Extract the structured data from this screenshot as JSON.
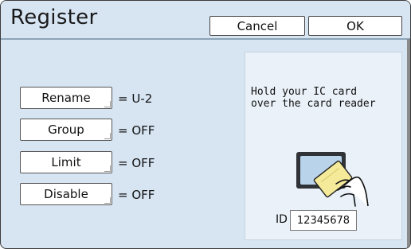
{
  "window": {
    "title": "Register"
  },
  "header": {
    "cancel_label": "Cancel",
    "ok_label": "OK"
  },
  "settings": [
    {
      "label": "Rename",
      "value": "= U-2"
    },
    {
      "label": "Group",
      "value": "= OFF"
    },
    {
      "label": "Limit",
      "value": "= OFF"
    },
    {
      "label": "Disable",
      "value": "= OFF"
    }
  ],
  "card_panel": {
    "instruction_line1": "Hold your IC card",
    "instruction_line2": "over the card reader",
    "id_label": "ID",
    "id_value": "12345678",
    "illustration": "card-reader-icon"
  },
  "colors": {
    "background": "#d7e5f3",
    "panel": "#eaf1f8",
    "reader": "#2f3338",
    "reader_screen": "#b9d3ea",
    "card": "#f4ea9a"
  }
}
